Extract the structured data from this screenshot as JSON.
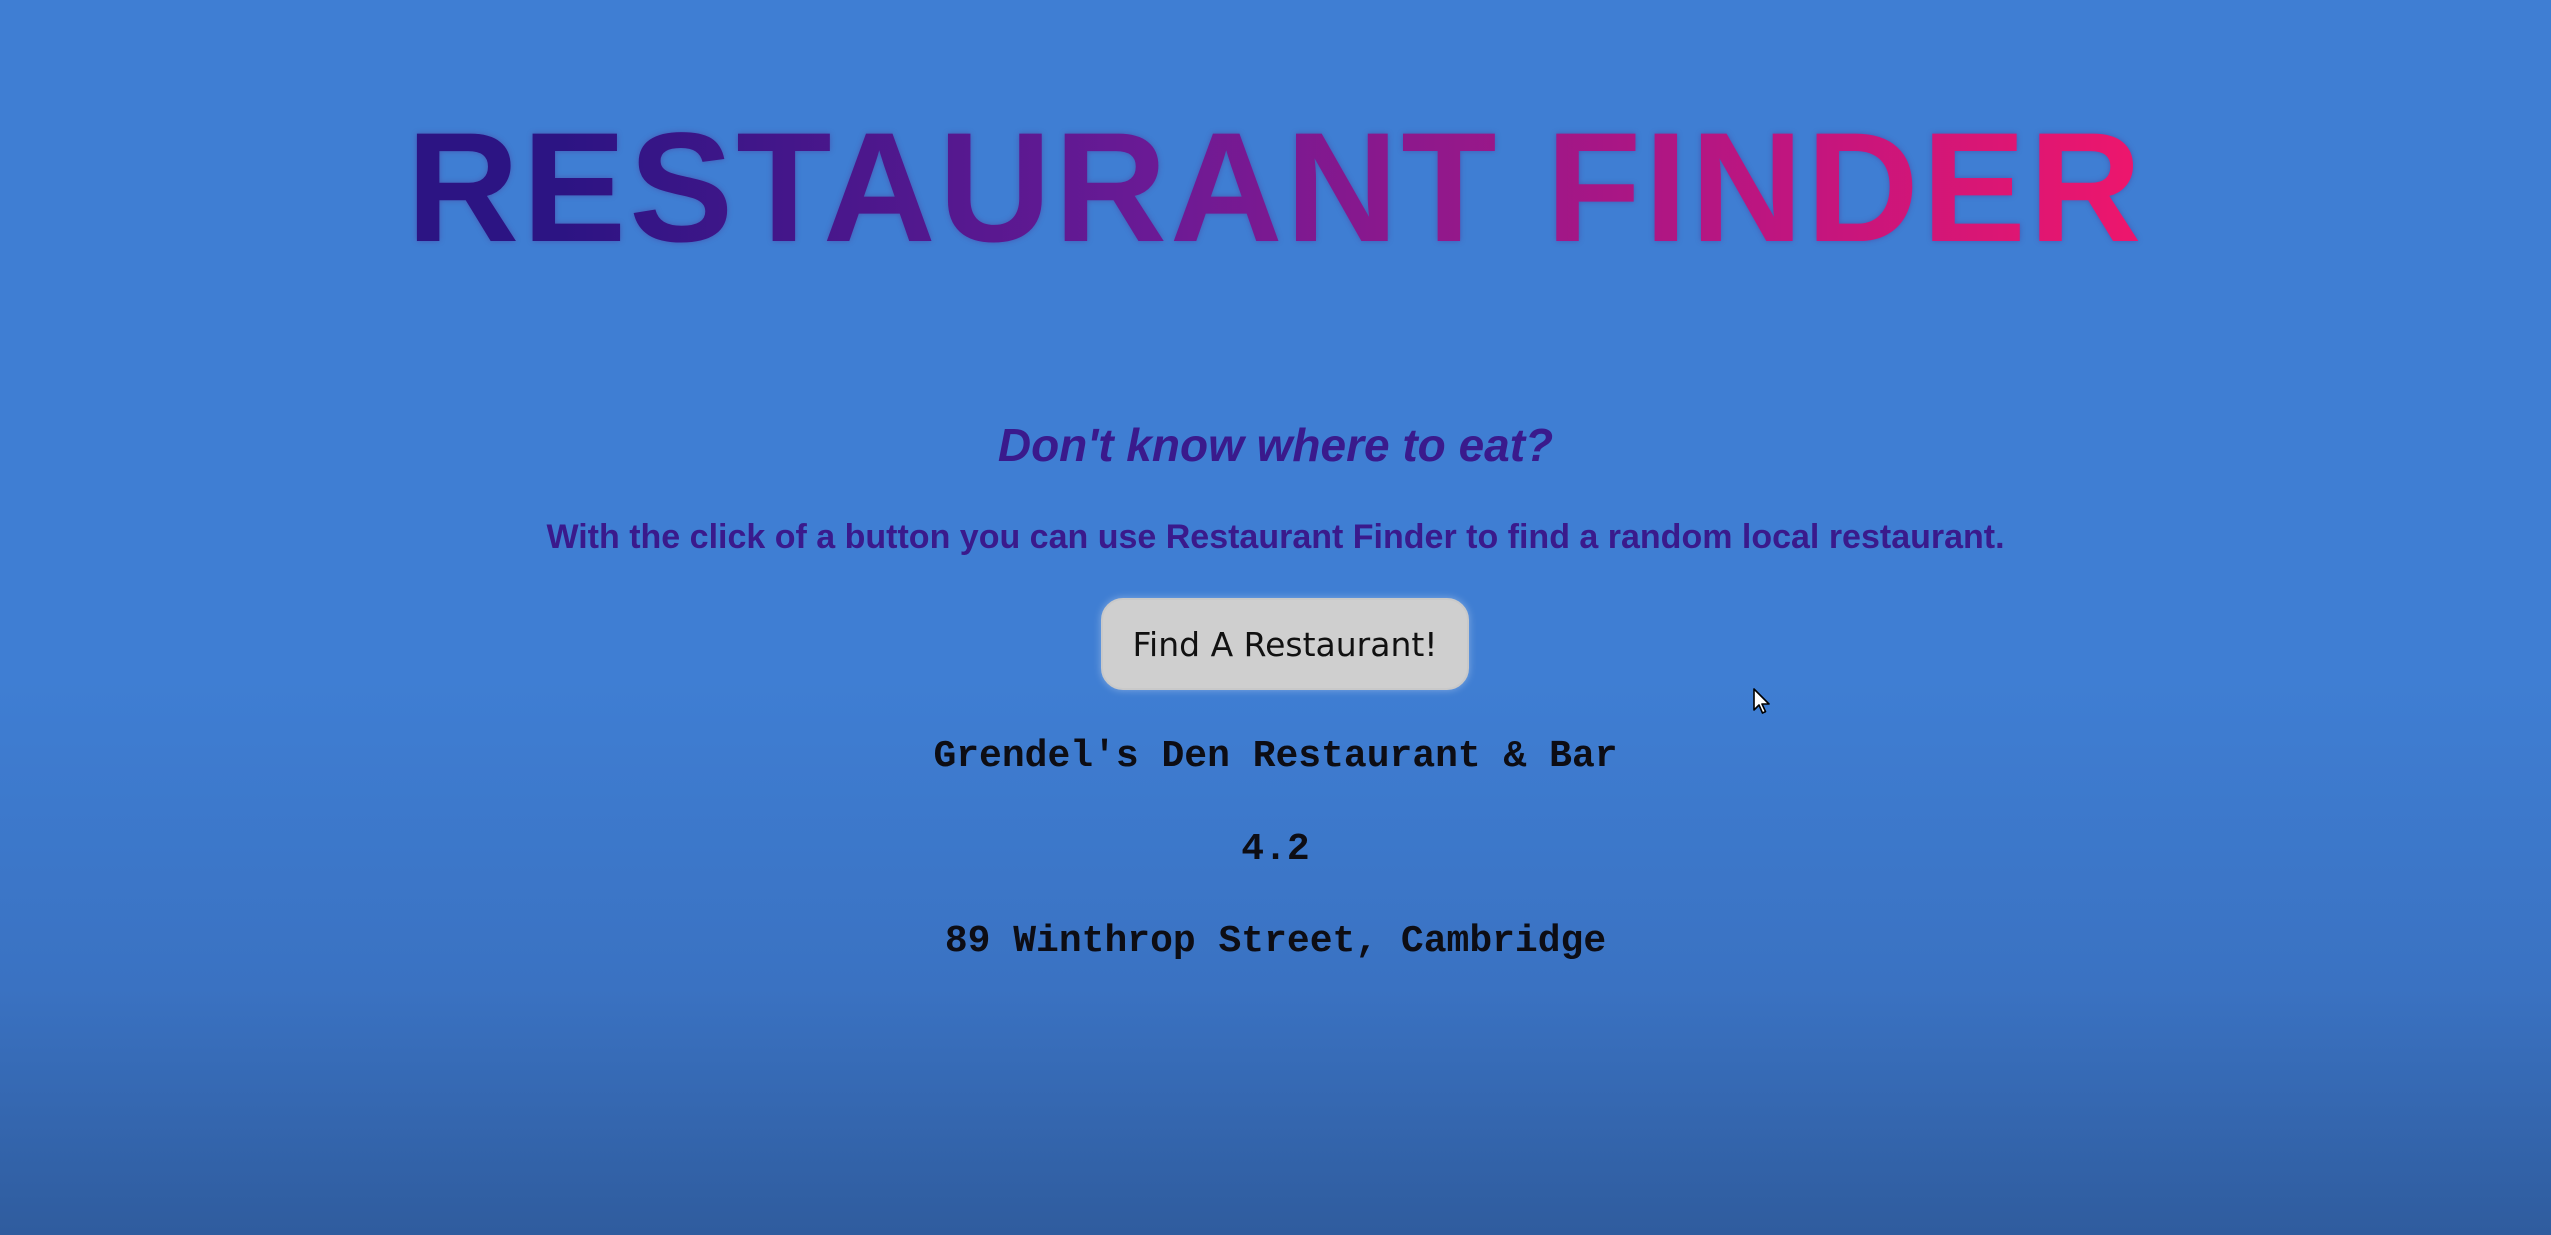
{
  "app": {
    "title": "RESTAURANT FINDER"
  },
  "intro": {
    "tagline": "Don't know where to eat?",
    "description": "With the click of a button you can use Restaurant Finder to find a random local restaurant."
  },
  "action": {
    "find_button_label": "Find A Restaurant!"
  },
  "result": {
    "name": "Grendel's Den Restaurant & Bar",
    "rating": "4.2",
    "address": "89 Winthrop Street, Cambridge"
  },
  "colors": {
    "background": "#3f7ed3",
    "title_start": "#2c1483",
    "title_end": "#ee166c",
    "heading_text": "#3a1a8c",
    "button_bg": "#cfcfcf",
    "result_text": "#0d0d14"
  },
  "icons": {
    "cursor": "mouse-pointer-icon"
  }
}
